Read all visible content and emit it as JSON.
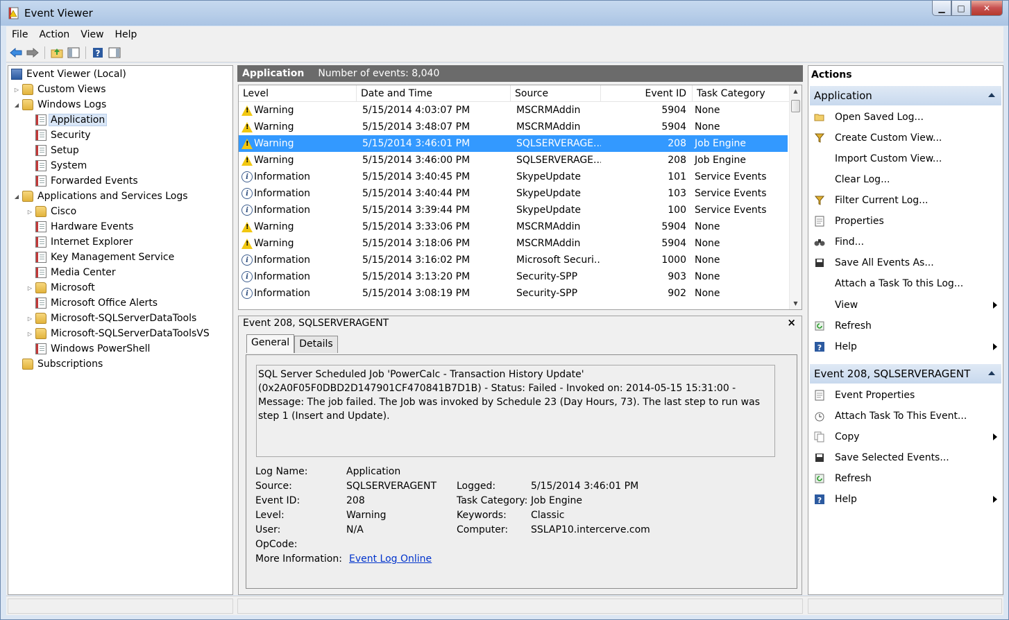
{
  "window": {
    "title": "Event Viewer"
  },
  "menu": [
    "File",
    "Action",
    "View",
    "Help"
  ],
  "tree": [
    {
      "label": "Event Viewer (Local)",
      "icon": "computer-icon",
      "expander": "",
      "level": 0
    },
    {
      "label": "Custom Views",
      "icon": "folder-icon",
      "expander": "▷",
      "level": 1
    },
    {
      "label": "Windows Logs",
      "icon": "folder-icon",
      "expander": "◢",
      "level": 1
    },
    {
      "label": "Application",
      "icon": "log-icon",
      "expander": "",
      "level": 2,
      "selected": true
    },
    {
      "label": "Security",
      "icon": "log-icon",
      "expander": "",
      "level": 2
    },
    {
      "label": "Setup",
      "icon": "log-icon",
      "expander": "",
      "level": 2
    },
    {
      "label": "System",
      "icon": "log-icon",
      "expander": "",
      "level": 2
    },
    {
      "label": "Forwarded Events",
      "icon": "log-icon",
      "expander": "",
      "level": 2
    },
    {
      "label": "Applications and Services Logs",
      "icon": "folder-icon",
      "expander": "◢",
      "level": 1
    },
    {
      "label": "Cisco",
      "icon": "folder-icon",
      "expander": "▷",
      "level": 2
    },
    {
      "label": "Hardware Events",
      "icon": "log-icon",
      "expander": "",
      "level": 2
    },
    {
      "label": "Internet Explorer",
      "icon": "log-icon",
      "expander": "",
      "level": 2
    },
    {
      "label": "Key Management Service",
      "icon": "log-icon",
      "expander": "",
      "level": 2
    },
    {
      "label": "Media Center",
      "icon": "log-icon",
      "expander": "",
      "level": 2
    },
    {
      "label": "Microsoft",
      "icon": "folder-icon",
      "expander": "▷",
      "level": 2
    },
    {
      "label": "Microsoft Office Alerts",
      "icon": "log-icon",
      "expander": "",
      "level": 2
    },
    {
      "label": "Microsoft-SQLServerDataTools",
      "icon": "folder-icon",
      "expander": "▷",
      "level": 2
    },
    {
      "label": "Microsoft-SQLServerDataToolsVS",
      "icon": "folder-icon",
      "expander": "▷",
      "level": 2
    },
    {
      "label": "Windows PowerShell",
      "icon": "log-icon",
      "expander": "",
      "level": 2
    },
    {
      "label": "Subscriptions",
      "icon": "folder-icon",
      "expander": "",
      "level": 1
    }
  ],
  "center_header": {
    "title": "Application",
    "count": "Number of events: 8,040"
  },
  "columns": [
    "Level",
    "Date and Time",
    "Source",
    "Event ID",
    "Task Category"
  ],
  "events": [
    {
      "level": "Warning",
      "date": "5/15/2014 4:03:07 PM",
      "source": "MSCRMAddin",
      "id": "5904",
      "category": "None"
    },
    {
      "level": "Warning",
      "date": "5/15/2014 3:48:07 PM",
      "source": "MSCRMAddin",
      "id": "5904",
      "category": "None"
    },
    {
      "level": "Warning",
      "date": "5/15/2014 3:46:01 PM",
      "source": "SQLSERVERAGE...",
      "id": "208",
      "category": "Job Engine",
      "selected": true
    },
    {
      "level": "Warning",
      "date": "5/15/2014 3:46:00 PM",
      "source": "SQLSERVERAGE...",
      "id": "208",
      "category": "Job Engine"
    },
    {
      "level": "Information",
      "date": "5/15/2014 3:40:45 PM",
      "source": "SkypeUpdate",
      "id": "101",
      "category": "Service Events"
    },
    {
      "level": "Information",
      "date": "5/15/2014 3:40:44 PM",
      "source": "SkypeUpdate",
      "id": "103",
      "category": "Service Events"
    },
    {
      "level": "Information",
      "date": "5/15/2014 3:39:44 PM",
      "source": "SkypeUpdate",
      "id": "100",
      "category": "Service Events"
    },
    {
      "level": "Warning",
      "date": "5/15/2014 3:33:06 PM",
      "source": "MSCRMAddin",
      "id": "5904",
      "category": "None"
    },
    {
      "level": "Warning",
      "date": "5/15/2014 3:18:06 PM",
      "source": "MSCRMAddin",
      "id": "5904",
      "category": "None"
    },
    {
      "level": "Information",
      "date": "5/15/2014 3:16:02 PM",
      "source": "Microsoft Securi...",
      "id": "1000",
      "category": "None"
    },
    {
      "level": "Information",
      "date": "5/15/2014 3:13:20 PM",
      "source": "Security-SPP",
      "id": "903",
      "category": "None"
    },
    {
      "level": "Information",
      "date": "5/15/2014 3:08:19 PM",
      "source": "Security-SPP",
      "id": "902",
      "category": "None"
    }
  ],
  "detail": {
    "header": "Event 208, SQLSERVERAGENT",
    "close": "×",
    "tabs": [
      "General",
      "Details"
    ],
    "message": "SQL Server Scheduled Job 'PowerCalc - Transaction History Update' (0x2A0F05F0DBD2D147901CF470841B7D1B) - Status: Failed - Invoked on: 2014-05-15 15:31:00 - Message: The job failed.  The Job was invoked by Schedule 23 (Day Hours, 73).  The last step to run was step 1 (Insert and Update).",
    "labels": {
      "log_name": "Log Name:",
      "source": "Source:",
      "event_id": "Event ID:",
      "level": "Level:",
      "user": "User:",
      "opcode": "OpCode:",
      "more_info": "More Information:",
      "logged": "Logged:",
      "task_category": "Task Category:",
      "keywords": "Keywords:",
      "computer": "Computer:"
    },
    "values": {
      "log_name": "Application",
      "source": "SQLSERVERAGENT",
      "event_id": "208",
      "level": "Warning",
      "user": "N/A",
      "opcode": "",
      "more_info": "Event Log Online",
      "logged": "5/15/2014 3:46:01 PM",
      "task_category": "Job Engine",
      "keywords": "Classic",
      "computer": "SSLAP10.intercerve.com"
    }
  },
  "actions": {
    "title": "Actions",
    "section1": "Application",
    "items1": [
      {
        "label": "Open Saved Log...",
        "icon": "open-folder-icon"
      },
      {
        "label": "Create Custom View...",
        "icon": "filter-icon"
      },
      {
        "label": "Import Custom View...",
        "icon": ""
      },
      {
        "label": "Clear Log...",
        "icon": ""
      },
      {
        "label": "Filter Current Log...",
        "icon": "filter-icon"
      },
      {
        "label": "Properties",
        "icon": "properties-icon"
      },
      {
        "label": "Find...",
        "icon": "binoculars-icon"
      },
      {
        "label": "Save All Events As...",
        "icon": "save-icon"
      },
      {
        "label": "Attach a Task To this Log...",
        "icon": ""
      },
      {
        "label": "View",
        "icon": "",
        "submenu": true
      },
      {
        "label": "Refresh",
        "icon": "refresh-icon"
      },
      {
        "label": "Help",
        "icon": "help-icon",
        "submenu": true
      }
    ],
    "section2": "Event 208, SQLSERVERAGENT",
    "items2": [
      {
        "label": "Event Properties",
        "icon": "properties-icon"
      },
      {
        "label": "Attach Task To This Event...",
        "icon": "task-icon"
      },
      {
        "label": "Copy",
        "icon": "copy-icon",
        "submenu": true
      },
      {
        "label": "Save Selected Events...",
        "icon": "save-icon"
      },
      {
        "label": "Refresh",
        "icon": "refresh-icon"
      },
      {
        "label": "Help",
        "icon": "help-icon",
        "submenu": true
      }
    ]
  }
}
